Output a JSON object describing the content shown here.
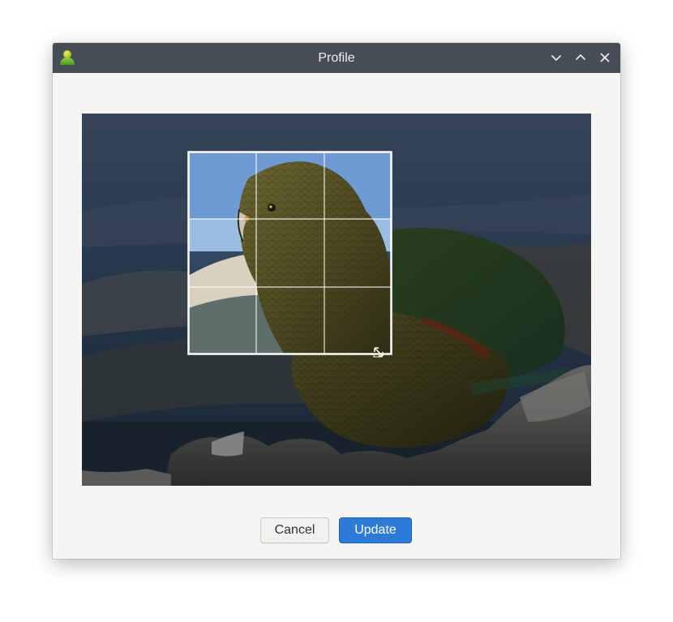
{
  "window": {
    "title": "Profile"
  },
  "titlebar_icons": {
    "app": "avatar-icon",
    "minimize": "chevron-down-icon",
    "maximize": "chevron-up-icon",
    "close": "close-icon"
  },
  "cropper": {
    "image": "photo-of-kea-parrot-on-rocks",
    "grid": "3x3",
    "handle": "resize-handle-icon"
  },
  "buttons": {
    "cancel": "Cancel",
    "update": "Update"
  },
  "colors": {
    "titlebar": "#464d55",
    "accent": "#2c7bd8",
    "background": "#f6f5f4"
  }
}
